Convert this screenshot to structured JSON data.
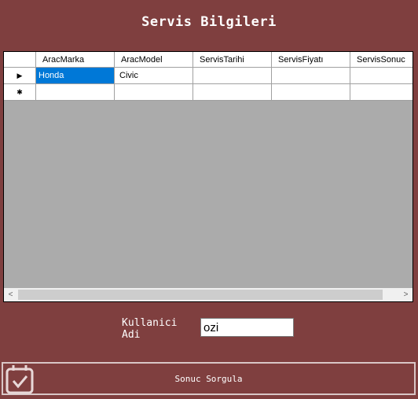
{
  "form": {
    "title": "Servis Bilgileri"
  },
  "grid": {
    "columns": [
      "AracMarka",
      "AracModel",
      "ServisTarihi",
      "ServisFiyatı",
      "ServisSonuc"
    ],
    "rows": [
      {
        "indicator": "▶",
        "cells": [
          "Honda",
          "Civic",
          "",
          "",
          ""
        ]
      },
      {
        "indicator": "✱",
        "cells": [
          "",
          "",
          "",
          "",
          ""
        ]
      }
    ],
    "scroll_left": "<",
    "scroll_right": ">"
  },
  "user": {
    "label": "Kullanici Adi",
    "value": "ozi"
  },
  "button": {
    "label": "Sonuc Sorgula",
    "icon": "calendar-check-icon"
  }
}
